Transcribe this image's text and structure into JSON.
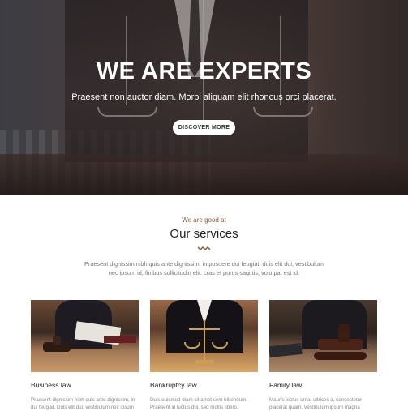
{
  "hero": {
    "title": "WE ARE EXPERTS",
    "subtitle": "Praesent non auctor diam. Morbi aliquam elit rhoncus orci placerat.",
    "button_label": "DISCOVER MORE"
  },
  "services": {
    "eyebrow": "We are good at",
    "title": "Our services",
    "intro": "Praesent dignissim nibh quis ante dignissim, in posuere dui feugiat. duis elit dui, vestibulum nec ipsum id, finibus sollicitudin elit. cras et purus sagittis, volutpat est id.",
    "accent_color": "#8a5a36",
    "cards": [
      {
        "title": "Business law",
        "text": "Praesent dignissim nibh quis ante dignissim, in",
        "text2": "dui feugiat. Duis elit dui, vestibulum nec ipsum"
      },
      {
        "title": "Bankruptcy law",
        "text": "Duis euismod diam sit amet sem bibendum.",
        "text2": "Praesent in luctus dui, sed mollis libero."
      },
      {
        "title": "Family law",
        "text": "Mauris lectus urna, ultrices a, consectetur",
        "text2": "placerat quam. Vestibulum ipsum magna"
      }
    ]
  }
}
